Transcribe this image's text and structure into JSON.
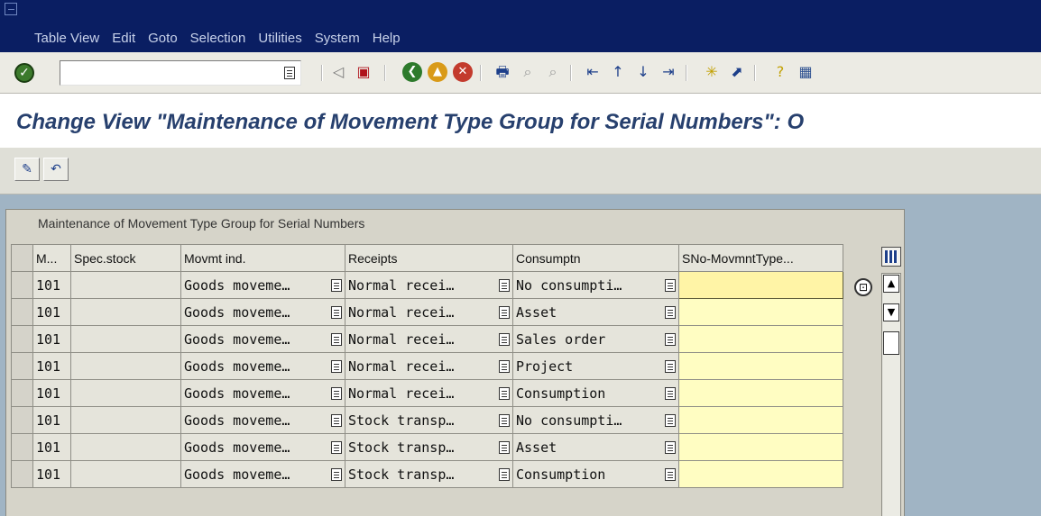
{
  "menu": {
    "items": [
      "Table View",
      "Edit",
      "Goto",
      "Selection",
      "Utilities",
      "System",
      "Help"
    ]
  },
  "toolbar": {
    "command_value": ""
  },
  "title": "Change View \"Maintenance of Movement Type Group for Serial Numbers\": O",
  "table": {
    "caption": "Maintenance of Movement Type Group for Serial Numbers",
    "columns": [
      "M...",
      "Spec.stock",
      "Movmt ind.",
      "Receipts",
      "Consumptn",
      "SNo-MovmntType..."
    ],
    "rows": [
      {
        "mvt": "101",
        "spec": "",
        "movmt": "Goods moveme…",
        "receipts": "Normal recei…",
        "consumptn": "No consumpti…",
        "sno": ""
      },
      {
        "mvt": "101",
        "spec": "",
        "movmt": "Goods moveme…",
        "receipts": "Normal recei…",
        "consumptn": "Asset",
        "sno": ""
      },
      {
        "mvt": "101",
        "spec": "",
        "movmt": "Goods moveme…",
        "receipts": "Normal recei…",
        "consumptn": "Sales order",
        "sno": ""
      },
      {
        "mvt": "101",
        "spec": "",
        "movmt": "Goods moveme…",
        "receipts": "Normal recei…",
        "consumptn": "Project",
        "sno": ""
      },
      {
        "mvt": "101",
        "spec": "",
        "movmt": "Goods moveme…",
        "receipts": "Normal recei…",
        "consumptn": "Consumption",
        "sno": ""
      },
      {
        "mvt": "101",
        "spec": "",
        "movmt": "Goods moveme…",
        "receipts": "Stock transp…",
        "consumptn": "No consumpti…",
        "sno": ""
      },
      {
        "mvt": "101",
        "spec": "",
        "movmt": "Goods moveme…",
        "receipts": "Stock transp…",
        "consumptn": "Asset",
        "sno": ""
      },
      {
        "mvt": "101",
        "spec": "",
        "movmt": "Goods moveme…",
        "receipts": "Stock transp…",
        "consumptn": "Consumption",
        "sno": ""
      }
    ]
  },
  "colors": {
    "menubar": "#0a1e62",
    "title": "#27406e",
    "input": "#fffdc2"
  },
  "icons": {
    "check": "check-icon",
    "save": "save-icon",
    "back": "back-icon",
    "exit": "exit-icon",
    "cancel": "cancel-icon",
    "print": "print-icon",
    "find": "find-icon",
    "find_next": "find-next-icon",
    "first_page": "first-page-icon",
    "prev_page": "previous-page-icon",
    "next_page": "next-page-icon",
    "last_page": "last-page-icon",
    "create_session": "create-session-icon",
    "shortcut": "shortcut-icon",
    "help": "help-icon",
    "layout": "customize-layout-icon"
  }
}
